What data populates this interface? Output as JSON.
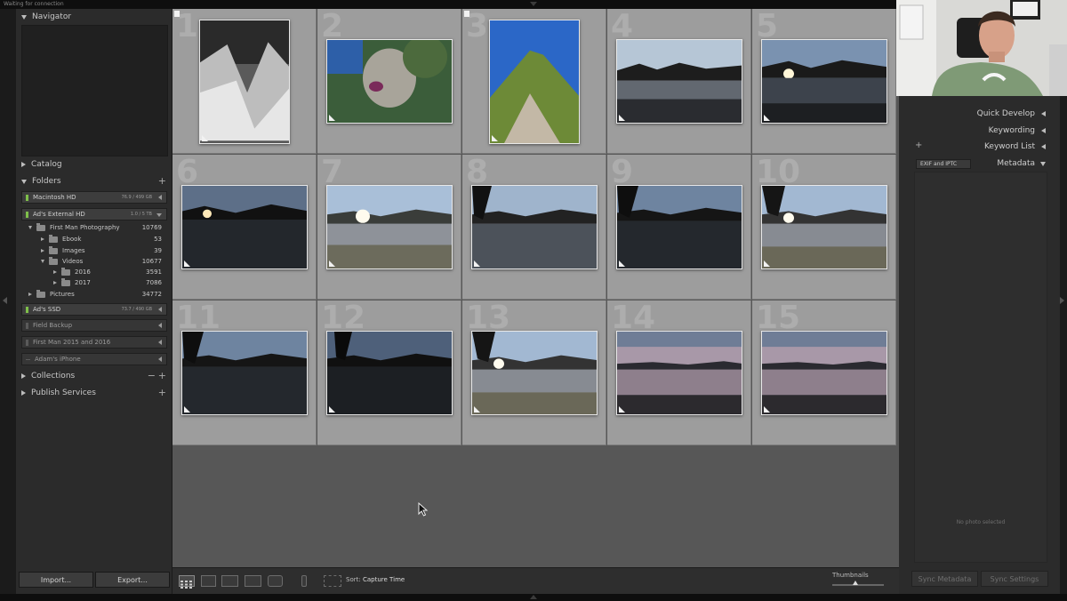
{
  "window": {
    "status_text": "Waiting for connection"
  },
  "left_panel": {
    "navigator": {
      "title": "Navigator"
    },
    "catalog": {
      "title": "Catalog"
    },
    "folders": {
      "title": "Folders",
      "add_symbol": "+"
    },
    "volumes": [
      {
        "name": "Macintosh HD",
        "capacity": "76.9 / 499 GB",
        "online": true
      },
      {
        "name": "Ad's External HD",
        "capacity": "1.0 / 5 TB",
        "online": true
      },
      {
        "name": "Ad's SSD",
        "capacity": "73.7 / 490 GB",
        "online": true
      },
      {
        "name": "Field Backup",
        "capacity": "",
        "online": false
      },
      {
        "name": "First Man 2015 and 2016",
        "capacity": "",
        "online": false
      },
      {
        "name": "Adam's iPhone",
        "capacity": "",
        "online": false
      }
    ],
    "folder_tree": [
      {
        "name": "First Man Photography",
        "count": "10769",
        "open": true
      },
      {
        "name": "Ebook",
        "count": "53",
        "open": false
      },
      {
        "name": "Images",
        "count": "39",
        "open": false
      },
      {
        "name": "Videos",
        "count": "10677",
        "open": true
      },
      {
        "name": "2016",
        "count": "3591",
        "open": false
      },
      {
        "name": "2017",
        "count": "7086",
        "open": false
      },
      {
        "name": "Pictures",
        "count": "34772",
        "open": false
      }
    ],
    "collections": {
      "title": "Collections",
      "add_symbol": "+",
      "remove_symbol": "−"
    },
    "publish_services": {
      "title": "Publish Services",
      "add_symbol": "+"
    },
    "import_label": "Import...",
    "export_label": "Export..."
  },
  "grid": {
    "cells": [
      {
        "index": "1",
        "scene": "bw-valley",
        "orientation": "portrait",
        "flagged": true
      },
      {
        "index": "2",
        "scene": "blur",
        "orientation": "landscape",
        "flagged": false
      },
      {
        "index": "3",
        "scene": "green-peak",
        "orientation": "portrait",
        "flagged": true
      },
      {
        "index": "4",
        "scene": "lake-dusk",
        "orientation": "landscape",
        "flagged": false
      },
      {
        "index": "5",
        "scene": "lake-sunstar",
        "orientation": "landscape",
        "flagged": false
      },
      {
        "index": "6",
        "scene": "lake-sunstar-dark",
        "orientation": "landscape",
        "flagged": false
      },
      {
        "index": "7",
        "scene": "lake-bright",
        "orientation": "landscape",
        "flagged": false
      },
      {
        "index": "8",
        "scene": "lake-tripod",
        "orientation": "landscape",
        "flagged": false
      },
      {
        "index": "9",
        "scene": "lake-tripod-dark",
        "orientation": "landscape",
        "flagged": false
      },
      {
        "index": "10",
        "scene": "lake-tripod-bright",
        "orientation": "landscape",
        "flagged": false
      },
      {
        "index": "11",
        "scene": "lake-tripod-dark",
        "orientation": "landscape",
        "flagged": false
      },
      {
        "index": "12",
        "scene": "lake-tripod-darker",
        "orientation": "landscape",
        "flagged": false
      },
      {
        "index": "13",
        "scene": "lake-tripod-bright",
        "orientation": "landscape",
        "flagged": false
      },
      {
        "index": "14",
        "scene": "lake-pink",
        "orientation": "landscape",
        "flagged": false
      },
      {
        "index": "15",
        "scene": "lake-pink",
        "orientation": "landscape",
        "flagged": false
      }
    ]
  },
  "toolbar": {
    "sort_label": "Sort:",
    "sort_value": "Capture Time",
    "thumbnails_label": "Thumbnails",
    "thumbnails_level": 0.45
  },
  "right_panel": {
    "quick_develop": "Quick Develop",
    "keywording": "Keywording",
    "keyword_list": "Keyword List",
    "keyword_add_symbol": "+",
    "metadata": "Metadata",
    "metadata_preset": "EXIF and IPTC",
    "no_photo_selected": "No photo selected",
    "sync_metadata": "Sync Metadata",
    "sync_settings": "Sync Settings"
  },
  "colors": {
    "panel_bg": "#2b2b2b",
    "grid_bg": "#575757",
    "cell_bg": "#9d9d9d",
    "online_led": "#7fbf4a"
  }
}
